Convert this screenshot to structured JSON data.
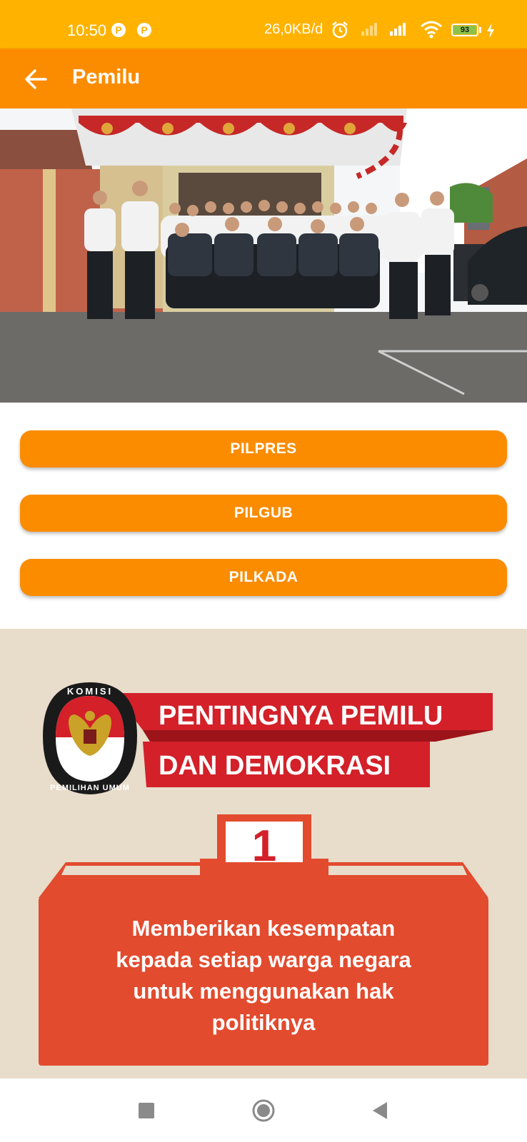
{
  "status_bar": {
    "time": "10:50",
    "notification_badges": [
      "P",
      "P"
    ],
    "net_speed": "26,0KB/d",
    "battery_level": "93"
  },
  "app_bar": {
    "title": "Pemilu"
  },
  "photo": {
    "banner_emblem": "garuda-bunting"
  },
  "buttons": [
    {
      "label": "PILPRES"
    },
    {
      "label": "PILGUB"
    },
    {
      "label": "PILKADA"
    }
  ],
  "infographic": {
    "logo_top_text": "KOMISI",
    "logo_bottom_text": "PEMILIHAN UMUM",
    "title_line1": "PENTINGNYA PEMILU",
    "title_line2": "DAN DEMOKRASI",
    "number": "1",
    "body_lines": [
      "Memberikan kesempatan",
      "kepada setiap warga negara",
      "untuk menggunakan hak",
      "politiknya"
    ]
  },
  "colors": {
    "status_bar": "#FFB300",
    "app_bar": "#FB8C00",
    "buttons": "#FB8C00",
    "infographic_bg": "#E8DCCA",
    "banner_red": "#D32029",
    "box_red": "#E24B2E"
  }
}
